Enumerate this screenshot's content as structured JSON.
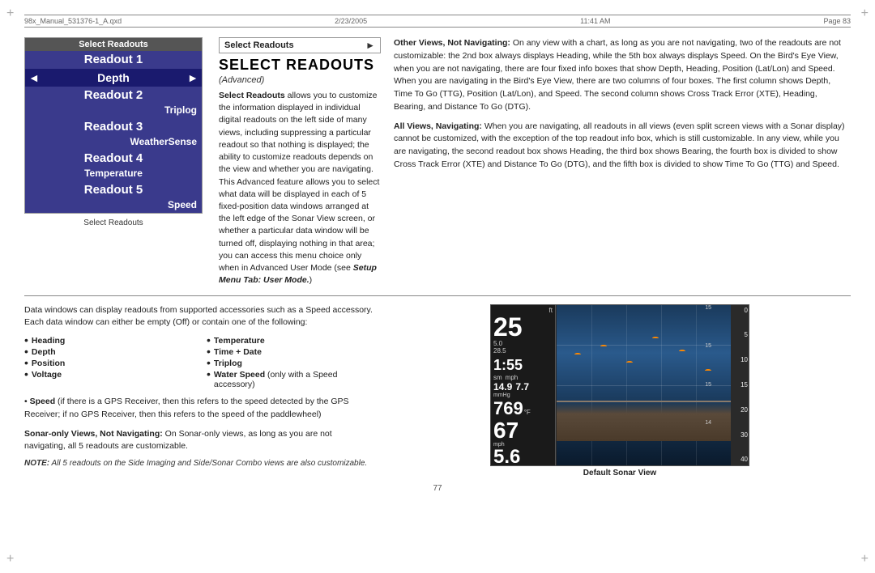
{
  "header": {
    "file": "98x_Manual_531376-1_A.qxd",
    "date": "2/23/2005",
    "time": "11:41 AM",
    "page": "Page 83"
  },
  "page_number": "77",
  "menu": {
    "header_label": "Select Readouts",
    "caption_label": "Select Readouts",
    "items": [
      {
        "label": "Readout 1",
        "type": "title"
      },
      {
        "label": "Depth",
        "type": "selected",
        "left_arrow": "◄",
        "right_arrow": "►"
      },
      {
        "label": "Readout 2",
        "type": "title"
      },
      {
        "label": "Triplog",
        "type": "subtitle"
      },
      {
        "label": "Readout 3",
        "type": "title"
      },
      {
        "label": "WeatherSense",
        "type": "subtitle"
      },
      {
        "label": "Readout 4",
        "type": "title"
      },
      {
        "label": "Temperature",
        "type": "subtitle"
      },
      {
        "label": "Readout 5",
        "type": "title"
      },
      {
        "label": "Speed",
        "type": "subtitle"
      }
    ]
  },
  "select_readouts_panel": {
    "title": "Select Readouts",
    "arrow": "►",
    "advanced_label": "(Advanced)",
    "description": "Select Readouts allows you to customize the information displayed in individual digital readouts on the left side of many views, including suppressing a particular readout so that nothing is displayed; the ability to customize readouts depends on the view and whether you are navigating. This Advanced feature allows you to select what data will be displayed in each of 5 fixed-position data windows arranged at the left edge of the Sonar View screen, or whether a particular data window will be turned off, displaying nothing in that area; you can access this menu choice only when in Advanced User Mode (see Setup Menu Tab: User Mode.)"
  },
  "main_title": "SELECT READOUTS",
  "right_column": {
    "para1_label": "Other Views, Not Navigating:",
    "para1": "On any view with a chart, as long as you are not navigating, two of the readouts are not customizable: the 2nd box always displays Heading, while the 5th box always displays Speed. On the Bird's Eye View, when you are not navigating, there are four fixed info boxes that show Depth, Heading, Position (Lat/Lon) and Speed. When you are navigating in the Bird's Eye View, there are two columns of four boxes. The first column shows Depth, Time To Go (TTG), Position (Lat/Lon), and Speed. The second column shows Cross Track Error (XTE), Heading, Bearing, and Distance To Go (DTG).",
    "para2_label": "All Views, Navigating:",
    "para2": "When you are navigating, all readouts in all views (even split screen views with a Sonar display) cannot be customized, with the exception of the top readout info box, which is still customizable. In any view, while you are navigating, the second readout box shows Heading, the third box shows Bearing, the fourth box is divided to show Cross Track Error (XTE) and Distance To Go (DTG), and the fifth box is divided to show Time To Go (TTG) and Speed."
  },
  "bottom_section": {
    "intro_text": "Data windows can display readouts from supported accessories such as a Speed accessory. Each data window can either be empty (Off) or contain one of the following:",
    "bullets": [
      {
        "label": "Heading",
        "col": 1
      },
      {
        "label": "Temperature",
        "col": 2
      },
      {
        "label": "Depth",
        "col": 1
      },
      {
        "label": "Time + Date",
        "col": 2
      },
      {
        "label": "Position",
        "col": 1
      },
      {
        "label": "Triplog",
        "col": 2
      },
      {
        "label": "Voltage",
        "col": 1
      },
      {
        "label": "Water Speed",
        "suffix": " (only with a Speed accessory)",
        "col": 2
      }
    ],
    "speed_note": "Speed (if there is a GPS Receiver, then this refers to the speed detected by the GPS Receiver; if no GPS Receiver, then this refers to the speed of the paddlewheel)",
    "sonar_only_label": "Sonar-only Views, Not Navigating:",
    "sonar_only_text": "On Sonar-only views, as long as you are not navigating, all 5 readouts are customizable.",
    "note_label": "NOTE:",
    "note_text": "All 5 readouts on the Side Imaging and Side/Sonar Combo views are also customizable."
  },
  "sonar": {
    "caption": "Default Sonar View",
    "ft_label": "ft",
    "big_number": "25",
    "small_nums": "5.0\n28.5",
    "time_val": "1:55",
    "sm_label": "sm",
    "mph_label": "mph",
    "speed_left": "14.9",
    "speed_right": "7.7",
    "mmhg_label": "mmHg",
    "temp_val": "769",
    "temp_unit": "°F",
    "large_num": "67",
    "mph2_label": "mph",
    "bottom_speed": "5.6",
    "scale": [
      "0",
      "5",
      "10",
      "15",
      "20",
      "30",
      "40"
    ]
  }
}
